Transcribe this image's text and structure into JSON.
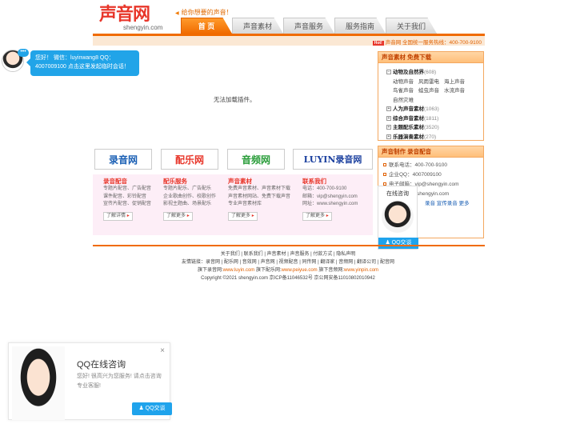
{
  "header": {
    "logo_text": "声音网",
    "logo_domain": "shengyin.com",
    "tagline": "给你想要的声音！",
    "hotline_badge": "Hot!",
    "hotline": "声音网 全国统一服务热线：400-700-9100"
  },
  "nav": {
    "tabs": [
      {
        "label": "首 页",
        "active": true
      },
      {
        "label": "声音素材",
        "active": false
      },
      {
        "label": "声音服务",
        "active": false
      },
      {
        "label": "服务指南",
        "active": false
      },
      {
        "label": "关于我们",
        "active": false
      }
    ]
  },
  "chat_popup": {
    "dots": "•••",
    "line1": "您好！ 微信：luyinwang8 QQ：",
    "line2": "4007009100 点击这里发起临时会话！"
  },
  "main": {
    "plugin_message": "无法加载插件。"
  },
  "sidebar_materials": {
    "title": "声音素材 免费下载",
    "tree": [
      {
        "expander": "−",
        "label": "动物及自然界",
        "count": "(608)",
        "expanded": true,
        "children": [
          [
            "动物声音",
            "风雨雷电",
            "海上声音"
          ],
          [
            "鸟雀声音",
            "蛙虫声音",
            "水流声音"
          ],
          [
            "自然灾难"
          ]
        ]
      },
      {
        "expander": "+",
        "label": "人为声音素材",
        "count": "(1063)"
      },
      {
        "expander": "+",
        "label": "综合声音素材",
        "count": "(1811)"
      },
      {
        "expander": "+",
        "label": "主题配乐素材",
        "count": "(3520)"
      },
      {
        "expander": "+",
        "label": "乐器演奏素材",
        "count": "(270)"
      }
    ]
  },
  "sidebar_contact": {
    "title": "声音制作 录音配音",
    "rows": [
      "联系电话：400-700-9100",
      "企业QQ：4007009100",
      "电子邮箱：vip@shengyin.com",
      "网址：www.shengyin.com"
    ],
    "links": "录音 宣传录音 更多"
  },
  "qq_float": {
    "title": "在线咨询",
    "button": "QQ交谈"
  },
  "brands": [
    {
      "text": "录音网",
      "color": "#1a5fb4"
    },
    {
      "text": "配乐网",
      "color": "#e8362a"
    },
    {
      "text": "音频网",
      "color": "#2a9d3a"
    },
    {
      "text": "LUYIN录音网",
      "color": "#1a3f9e"
    }
  ],
  "services": [
    {
      "title": "录音配音",
      "lines": [
        "专题片配音、广告配音",
        "课件配音、彩铃配音",
        "宣传片配音、促销配音"
      ],
      "button": "了解详情"
    },
    {
      "title": "配乐服务",
      "lines": [
        "专题片配乐、广告配乐",
        "企业歌曲创作、校歌创作",
        "影视主题曲、场景配乐"
      ],
      "button": "了解更多"
    },
    {
      "title": "声音素材",
      "lines": [
        "免费声音素材、声音素材下载",
        "声音素材网站、免费下载声音",
        "专业声音素材库"
      ],
      "button": "了解更多"
    },
    {
      "title": "联系我们",
      "lines": [
        "电话：400-700-9100",
        "邮箱：vip@shengyin.com",
        "网址：www.shengyin.com"
      ],
      "button": "了解更多"
    }
  ],
  "footer": {
    "links_row": "关于我们 | 联系我们 | 声音素材 | 声音服务 | 付款方式 | 隐私声明",
    "friends_row": "友情链接：录音网 | 配乐网 | 音效网 | 声音网 | 视频配音 | 同传网 | 翻译家 | 音频网 | 翻译公司 | 配音网",
    "sites_prefix1": "旗下录音网:",
    "sites_link1": "www.luyin.com",
    "sites_prefix2": "旗下配乐网:",
    "sites_link2": "www.peiyue.com",
    "sites_prefix3": "旗下音频网:",
    "sites_link3": "www.yinpin.com",
    "copyright": "Copyright ©2021 shengyin.com 京ICP备11046532号 京公网安备110108020109​42"
  },
  "qq_card": {
    "title": "QQ在线咨询",
    "text": "您好! 很高兴为您服务! 请点击咨询专业客服!",
    "close": "×",
    "button": "QQ交谈"
  },
  "colors": {
    "accent": "#f06b00",
    "brand_red": "#e8362a",
    "qq_blue": "#1fa3ec"
  }
}
